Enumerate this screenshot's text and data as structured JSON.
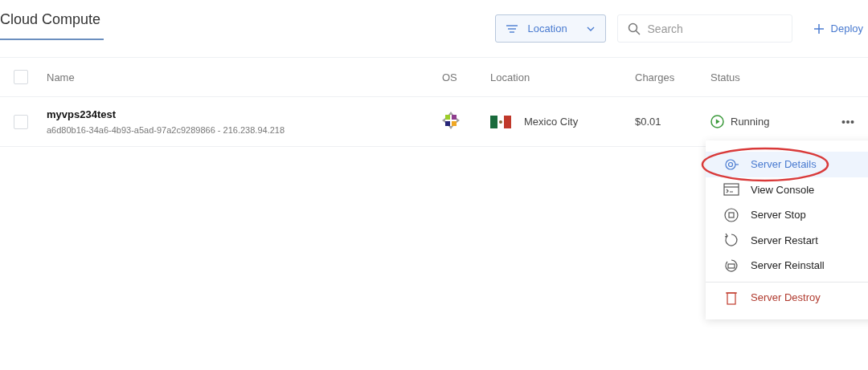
{
  "header": {
    "title": "Cloud Compute",
    "filter": {
      "label": "Location"
    },
    "search": {
      "placeholder": "Search"
    },
    "deploy": {
      "label": "Deploy"
    }
  },
  "table": {
    "select_all": {
      "checked": false
    },
    "columns": [
      "Name",
      "OS",
      "Location",
      "Charges",
      "Status"
    ],
    "rows": [
      {
        "checked": false,
        "name": "myvps234test",
        "detail": "a6d80b16-34a6-4b93-a5ad-97a2c9289866 - 216.238.94.218",
        "location": "Mexico City",
        "charges": "$0.01",
        "status": "Running"
      }
    ]
  },
  "menu": [
    {
      "kind": "details",
      "label": "Server Details",
      "selected": true,
      "circled": true
    },
    {
      "kind": "console",
      "label": "View Console",
      "selected": false,
      "circled": false
    },
    {
      "kind": "stop",
      "label": "Server Stop",
      "selected": false,
      "circled": false
    },
    {
      "kind": "restart",
      "label": "Server Restart",
      "selected": false,
      "circled": false
    },
    {
      "kind": "reinstall",
      "label": "Server Reinstall",
      "selected": false,
      "circled": false
    },
    {
      "kind": "destroy",
      "label": "Server Destroy",
      "selected": false,
      "circled": false
    }
  ]
}
